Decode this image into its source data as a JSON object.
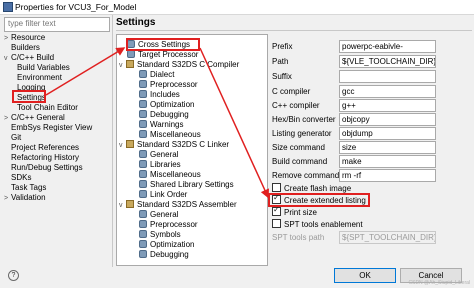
{
  "window": {
    "title": "Properties for VCU3_For_Model"
  },
  "filter": {
    "placeholder": "type filter text"
  },
  "nav": [
    {
      "label": "Resource",
      "toggle": ">"
    },
    {
      "label": "Builders",
      "toggle": ""
    },
    {
      "label": "C/C++ Build",
      "toggle": "v"
    },
    {
      "label": "Build Variables",
      "toggle": ""
    },
    {
      "label": "Environment",
      "toggle": ""
    },
    {
      "label": "Logging",
      "toggle": ""
    },
    {
      "label": "Settings",
      "toggle": ""
    },
    {
      "label": "Tool Chain Editor",
      "toggle": ""
    },
    {
      "label": "C/C++ General",
      "toggle": ">"
    },
    {
      "label": "EmbSys Register View",
      "toggle": ""
    },
    {
      "label": "Git",
      "toggle": ""
    },
    {
      "label": "Project References",
      "toggle": ""
    },
    {
      "label": "Refactoring History",
      "toggle": ""
    },
    {
      "label": "Run/Debug Settings",
      "toggle": ""
    },
    {
      "label": "SDKs",
      "toggle": ""
    },
    {
      "label": "Task Tags",
      "toggle": ""
    },
    {
      "label": "Validation",
      "toggle": ">"
    }
  ],
  "settings": {
    "title": "Settings"
  },
  "tree": [
    {
      "label": "Cross Settings",
      "icon": "gear"
    },
    {
      "label": "Target Processor",
      "icon": "gear"
    },
    {
      "label": "Standard S32DS C Compiler",
      "icon": "tool",
      "toggle": "v"
    },
    {
      "label": "Dialect",
      "icon": "gear"
    },
    {
      "label": "Preprocessor",
      "icon": "gear"
    },
    {
      "label": "Includes",
      "icon": "gear"
    },
    {
      "label": "Optimization",
      "icon": "gear"
    },
    {
      "label": "Debugging",
      "icon": "gear"
    },
    {
      "label": "Warnings",
      "icon": "gear"
    },
    {
      "label": "Miscellaneous",
      "icon": "gear"
    },
    {
      "label": "Standard S32DS C Linker",
      "icon": "tool",
      "toggle": "v"
    },
    {
      "label": "General",
      "icon": "gear"
    },
    {
      "label": "Libraries",
      "icon": "gear"
    },
    {
      "label": "Miscellaneous",
      "icon": "gear"
    },
    {
      "label": "Shared Library Settings",
      "icon": "gear"
    },
    {
      "label": "Link Order",
      "icon": "gear"
    },
    {
      "label": "Standard S32DS Assembler",
      "icon": "tool",
      "toggle": "v"
    },
    {
      "label": "General",
      "icon": "gear"
    },
    {
      "label": "Preprocessor",
      "icon": "gear"
    },
    {
      "label": "Symbols",
      "icon": "gear"
    },
    {
      "label": "Optimization",
      "icon": "gear"
    },
    {
      "label": "Debugging",
      "icon": "gear"
    },
    {
      "label": "Miscellaneous",
      "icon": "gear"
    }
  ],
  "props": [
    {
      "label": "Prefix",
      "value": "powerpc-eabivle-"
    },
    {
      "label": "Path",
      "value": "${VLE_TOOLCHAIN_DIR}/bin"
    },
    {
      "label": "Suffix",
      "value": ""
    },
    {
      "label": "C compiler",
      "value": "gcc"
    },
    {
      "label": "C++ compiler",
      "value": "g++"
    },
    {
      "label": "Hex/Bin converter",
      "value": "objcopy"
    },
    {
      "label": "Listing generator",
      "value": "objdump"
    },
    {
      "label": "Size command",
      "value": "size"
    },
    {
      "label": "Build command",
      "value": "make"
    },
    {
      "label": "Remove command",
      "value": "rm -rf"
    }
  ],
  "checks": [
    {
      "label": "Create flash image",
      "checked": false
    },
    {
      "label": "Create extended listing",
      "checked": true
    },
    {
      "label": "Print size",
      "checked": true
    },
    {
      "label": "SPT tools enablement",
      "checked": false
    }
  ],
  "spt": {
    "label": "SPT tools path",
    "value": "${SPT_TOOLCHAIN_DIR}/bin"
  },
  "buttons": {
    "ok": "OK",
    "cancel": "Cancel"
  },
  "watermark": "CSDN @Ah_Stupid_Liberal"
}
